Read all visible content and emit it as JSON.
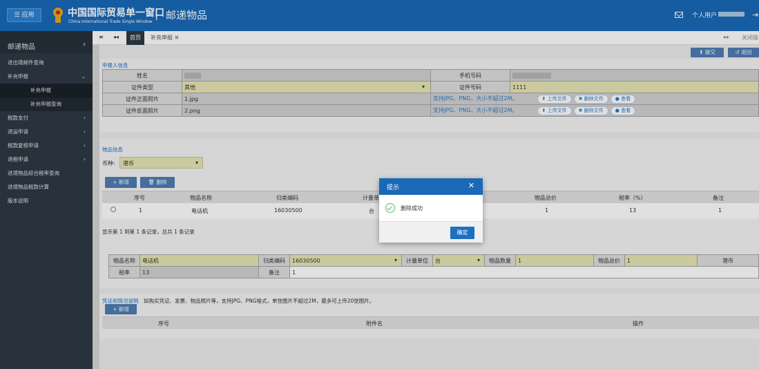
{
  "header": {
    "app_button": "☰ 应用",
    "brand_cn": "中国国际贸易单一窗口",
    "brand_en": "China International Trade Single Window",
    "separator": "|",
    "page_name": "邮递物品",
    "user_label": "个人用户",
    "logout_icon": "logout-icon"
  },
  "sidebar": {
    "title": "邮递物品",
    "collapse": "‹",
    "items": [
      {
        "label": "进出境邮件查询",
        "arrow": ""
      },
      {
        "label": "补充申报",
        "arrow": "⌄"
      },
      {
        "label": "补充申报",
        "arrow": ""
      },
      {
        "label": "补充申报查询",
        "arrow": ""
      },
      {
        "label": "税款支付",
        "arrow": "‹"
      },
      {
        "label": "退运申请",
        "arrow": "‹"
      },
      {
        "label": "税款复核申请",
        "arrow": "‹"
      },
      {
        "label": "退税申请",
        "arrow": "‹"
      },
      {
        "label": "进境物品综合税率查询",
        "arrow": ""
      },
      {
        "label": "进境物品税款计算",
        "arrow": ""
      },
      {
        "label": "版本说明",
        "arrow": ""
      }
    ]
  },
  "tabs": {
    "menu_icon": "≡",
    "back_icon": "◂◂",
    "home": "首页",
    "current": "补充申报",
    "forward_icon": "▸▸",
    "close_label": "关闭操"
  },
  "actions": {
    "submit": "⬆ 提交",
    "back": "↺ 返回"
  },
  "applicant": {
    "title": "申报人信息",
    "name_label": "姓名",
    "phone_label": "手机号码",
    "id_type_label": "证件类型",
    "id_type_value": "其他",
    "id_no_label": "证件号码",
    "id_no_value": "1111",
    "front_label": "证件正面照片",
    "front_value": "1.jpg",
    "back_label": "证件反面照片",
    "back_value": "2.png",
    "upload_hint": "支持JPG、PNG，大小不超过2M。",
    "upload_btn": "⬆ 上传文件",
    "delete_btn": "✖ 删除文件",
    "view_btn": "● 查看"
  },
  "goods": {
    "title": "物品信息",
    "currency_label": "币种:",
    "currency_value": "港币",
    "add_btn": "+ 新增",
    "delete_btn": "🗑 删除",
    "columns": [
      "序号",
      "物品名称",
      "归类编码",
      "计量单位",
      "物品总价",
      "税率（%）",
      "备注"
    ],
    "rows": [
      {
        "index": "1",
        "name": "电话机",
        "code": "16030500",
        "unit": "台",
        "total": "1",
        "rate": "13",
        "remark": "1"
      }
    ],
    "pagination": "显示第 1 到第 1 条记录，总共 1 条记录"
  },
  "detail": {
    "name_label": "物品名称",
    "name_value": "电话机",
    "code_label": "归类编码",
    "code_value": "16030500",
    "unit_label": "计量单位",
    "unit_value": "台",
    "qty_label": "物品数量",
    "qty_value": "1",
    "total_label": "物品总价",
    "total_value": "1",
    "currency_value": "港币",
    "rate_label": "税率",
    "rate_value": "13",
    "remark_label": "备注",
    "remark_value": "1"
  },
  "evidence": {
    "title": "凭证和情况说明",
    "hint": "如购买凭证、发票、物品照片等，支持JPG、PNG格式，单张图片不超过2M，最多可上传20张图片。",
    "add_btn": "+ 新增",
    "columns": [
      "序号",
      "附件名",
      "操作"
    ]
  },
  "modal": {
    "title": "提示",
    "close": "✕",
    "message": "删除成功",
    "ok": "确定"
  }
}
